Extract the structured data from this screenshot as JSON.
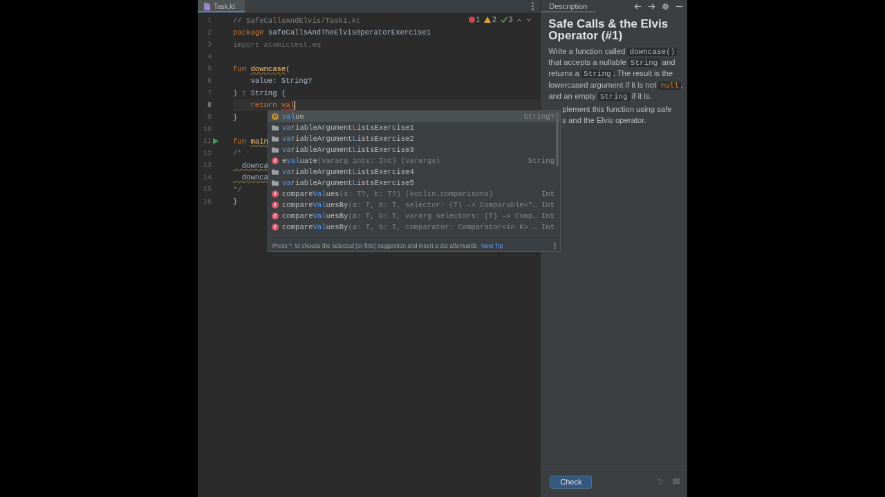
{
  "editor": {
    "tabs": [
      {
        "label": "Task.kt",
        "selected": true
      }
    ],
    "inspections": {
      "errors": "1",
      "warnings": "2",
      "passed": "3"
    },
    "lines": [
      {
        "number": "1",
        "tokens": [
          {
            "kind": "comment",
            "text": "// SafeCallsAndElvis/Task1.kt"
          }
        ]
      },
      {
        "number": "2",
        "tokens": [
          {
            "kind": "keyword",
            "text": "package "
          },
          {
            "kind": "plain",
            "text": "safeCallsAndTheElvisOperatorExercise1"
          }
        ]
      },
      {
        "number": "3",
        "tokens": [
          {
            "kind": "unused",
            "text": "import atomictest.eq"
          }
        ]
      },
      {
        "number": "4"
      },
      {
        "number": "5",
        "tokens": [
          {
            "kind": "keyword",
            "text": "fun "
          },
          {
            "kind": "function",
            "text": "downcase"
          },
          {
            "kind": "plain",
            "text": "("
          }
        ]
      },
      {
        "number": "6",
        "tokens": [
          {
            "kind": "param",
            "text": "    value"
          },
          {
            "kind": "plain",
            "text": ": String?"
          }
        ]
      },
      {
        "number": "7",
        "tokens": [
          {
            "kind": "plain",
            "text": ") : String {"
          }
        ]
      },
      {
        "number": "8",
        "current": true,
        "tokens": [
          {
            "kind": "keyword",
            "text": "    return "
          },
          {
            "kind": "error",
            "text": "val"
          }
        ]
      },
      {
        "number": "9",
        "tokens": [
          {
            "kind": "plain",
            "text": "}"
          }
        ]
      },
      {
        "number": "10"
      },
      {
        "number": "11",
        "runnable": true,
        "tokens": [
          {
            "kind": "keyword",
            "text": "fun "
          },
          {
            "kind": "function",
            "text": "main"
          }
        ]
      },
      {
        "number": "12",
        "tokens": [
          {
            "kind": "comment",
            "text": "/*"
          }
        ]
      },
      {
        "number": "13",
        "tokens": [
          {
            "kind": "squiggle",
            "text": "  downca"
          }
        ]
      },
      {
        "number": "14",
        "tokens": [
          {
            "kind": "squiggle",
            "text": "  downca"
          }
        ]
      },
      {
        "number": "15",
        "tokens": [
          {
            "kind": "comment",
            "text": "*/"
          }
        ]
      },
      {
        "number": "16",
        "tokens": [
          {
            "kind": "plain",
            "text": "}"
          }
        ]
      }
    ]
  },
  "completion": {
    "items": [
      {
        "kind": "property",
        "selected": true,
        "segments": [
          {
            "text": "val",
            "match": true
          },
          {
            "text": "ue",
            "match": false
          }
        ],
        "type": "String?"
      },
      {
        "kind": "package",
        "selected": false,
        "segments": [
          {
            "text": "va",
            "match": true
          },
          {
            "text": "riableArgument",
            "match": false
          },
          {
            "text": "L",
            "match": true
          },
          {
            "text": "istsExercise1",
            "match": false
          }
        ]
      },
      {
        "kind": "package",
        "selected": false,
        "segments": [
          {
            "text": "va",
            "match": true
          },
          {
            "text": "riableArgument",
            "match": false
          },
          {
            "text": "L",
            "match": true
          },
          {
            "text": "istsExercise2",
            "match": false
          }
        ]
      },
      {
        "kind": "package",
        "selected": false,
        "segments": [
          {
            "text": "va",
            "match": true
          },
          {
            "text": "riableArgument",
            "match": false
          },
          {
            "text": "L",
            "match": true
          },
          {
            "text": "istsExercise3",
            "match": false
          }
        ]
      },
      {
        "kind": "function",
        "selected": false,
        "segments": [
          {
            "text": "e",
            "match": false
          },
          {
            "text": "val",
            "match": true
          },
          {
            "text": "uate",
            "match": false
          }
        ],
        "signature": "(vararg ints: Int) (varargs)",
        "type": "String"
      },
      {
        "kind": "package",
        "selected": false,
        "segments": [
          {
            "text": "va",
            "match": true
          },
          {
            "text": "riableArgument",
            "match": false
          },
          {
            "text": "L",
            "match": true
          },
          {
            "text": "istsExercise4",
            "match": false
          }
        ]
      },
      {
        "kind": "package",
        "selected": false,
        "segments": [
          {
            "text": "va",
            "match": true
          },
          {
            "text": "riableArgument",
            "match": false
          },
          {
            "text": "L",
            "match": true
          },
          {
            "text": "istsExercise5",
            "match": false
          }
        ]
      },
      {
        "kind": "function",
        "selected": false,
        "segments": [
          {
            "text": "compare",
            "match": false
          },
          {
            "text": "Val",
            "match": true
          },
          {
            "text": "ues",
            "match": false
          }
        ],
        "signature": "(a: T?, b: T?) (kotlin.comparisons)",
        "type": "Int"
      },
      {
        "kind": "function",
        "selected": false,
        "segments": [
          {
            "text": "compare",
            "match": false
          },
          {
            "text": "Val",
            "match": true
          },
          {
            "text": "uesBy",
            "match": false
          }
        ],
        "signature": "(a: T, b: T, selector: (T) -> Comparable<*…",
        "type": "Int"
      },
      {
        "kind": "function",
        "selected": false,
        "segments": [
          {
            "text": "compare",
            "match": false
          },
          {
            "text": "Val",
            "match": true
          },
          {
            "text": "uesBy",
            "match": false
          }
        ],
        "signature": "(a: T, b: T, vararg selectors: (T) -> Comp…",
        "type": "Int"
      },
      {
        "kind": "function",
        "selected": false,
        "segments": [
          {
            "text": "compare",
            "match": false
          },
          {
            "text": "Val",
            "match": true
          },
          {
            "text": "uesBy",
            "match": false
          }
        ],
        "signature": "(a: T, b: T, comparator: Comparator<in K> …",
        "type": "Int"
      }
    ],
    "hint": "Press ^. to choose the selected (or first) suggestion and insert a dot afterwards",
    "hint_link": "Next Tip"
  },
  "panel": {
    "tabs": [
      {
        "label": "Description",
        "selected": true
      }
    ],
    "title": "Safe Calls & the Elvis Operator (#1)",
    "lines": [
      {
        "covered": false,
        "segments": [
          {
            "kind": "text",
            "text": "Write a function called "
          },
          {
            "kind": "code",
            "text": "downcase()"
          }
        ]
      },
      {
        "covered": false,
        "segments": [
          {
            "kind": "text",
            "text": "that accepts a nullable "
          },
          {
            "kind": "code",
            "text": "String"
          },
          {
            "kind": "text",
            "text": " and"
          }
        ]
      },
      {
        "covered": false,
        "segments": [
          {
            "kind": "text",
            "text": "returns a "
          },
          {
            "kind": "code",
            "text": "String"
          },
          {
            "kind": "text",
            "text": ". The result is the"
          }
        ]
      },
      {
        "covered": false,
        "segments": [
          {
            "kind": "text",
            "text": "lowercased argument if it is not "
          },
          {
            "kind": "literal",
            "text": "null"
          },
          {
            "kind": "text",
            "text": ","
          }
        ]
      },
      {
        "covered": false,
        "segments": [
          {
            "kind": "text",
            "text": "and an empty "
          },
          {
            "kind": "code",
            "text": "String"
          },
          {
            "kind": "text",
            "text": " if it is."
          }
        ]
      },
      {
        "covered": true,
        "segments": [
          {
            "kind": "text",
            "text": "plement this function using safe"
          }
        ]
      },
      {
        "covered": true,
        "segments": [
          {
            "kind": "text",
            "text": "s and the Elvis operator."
          }
        ]
      }
    ],
    "check_button": "Check"
  }
}
